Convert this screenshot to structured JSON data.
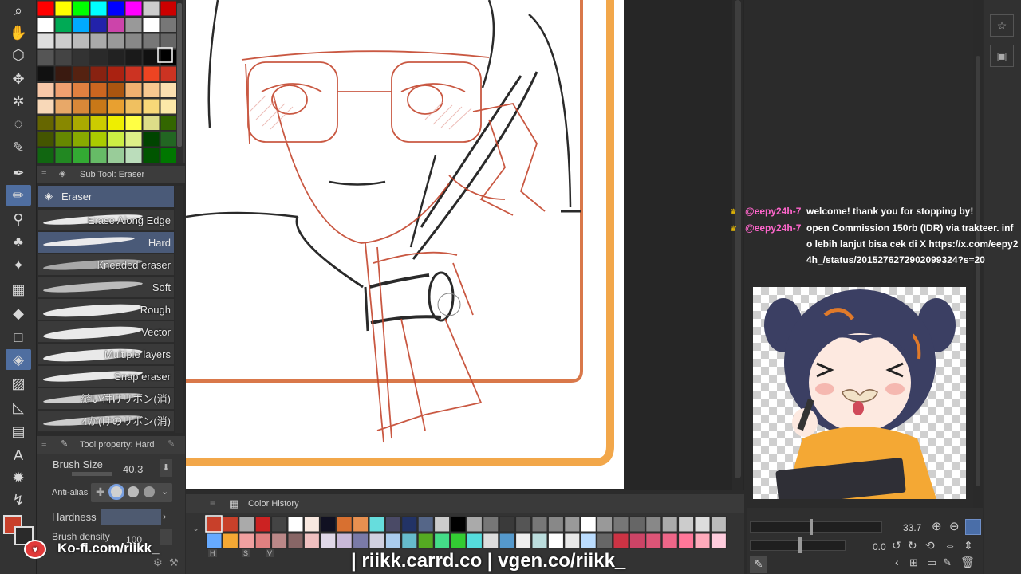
{
  "subtool": {
    "header": "Sub Tool: Eraser",
    "group": "Eraser",
    "brushes": [
      {
        "label": "Erase Along Edge"
      },
      {
        "label": "Hard"
      },
      {
        "label": "Kneaded eraser"
      },
      {
        "label": "Soft"
      },
      {
        "label": "Rough"
      },
      {
        "label": "Vector"
      },
      {
        "label": "Multiple layers"
      },
      {
        "label": "Snap eraser"
      },
      {
        "label": "縫い付けリボン(消)"
      },
      {
        "label": "4か(けのリボン(消)"
      }
    ]
  },
  "toolprop": {
    "header": "Tool property: Hard",
    "brush_size_label": "Brush Size",
    "brush_size_value": "40.3",
    "anti_alias_label": "Anti-alias",
    "hardness_label": "Hardness",
    "brush_density_label": "Brush density",
    "brush_density_value": "100"
  },
  "color_history": {
    "title": "Color History",
    "bottom_labels": [
      "H",
      "S",
      "V"
    ]
  },
  "navigator": {
    "zoom": "33.7",
    "rotate": "0.0"
  },
  "chat": [
    {
      "user": "@eepy24h-7",
      "message": "welcome! thank you for stopping by!"
    },
    {
      "user": "@eepy24h-7",
      "message": "open Commission 150rb (IDR) via trakteer. info lebih lanjut bisa cek di X https://x.com/eepy24h_/status/2015276272902099324?s=20"
    }
  ],
  "overlay": {
    "links": "| riikk.carrd.co | vgen.co/riikk_",
    "kofi": "Ko-fi.com/riikk_"
  },
  "colors": {
    "main_color": "#c8402a",
    "accent_orange": "#f2a74a",
    "selection": "#4a5a78"
  }
}
